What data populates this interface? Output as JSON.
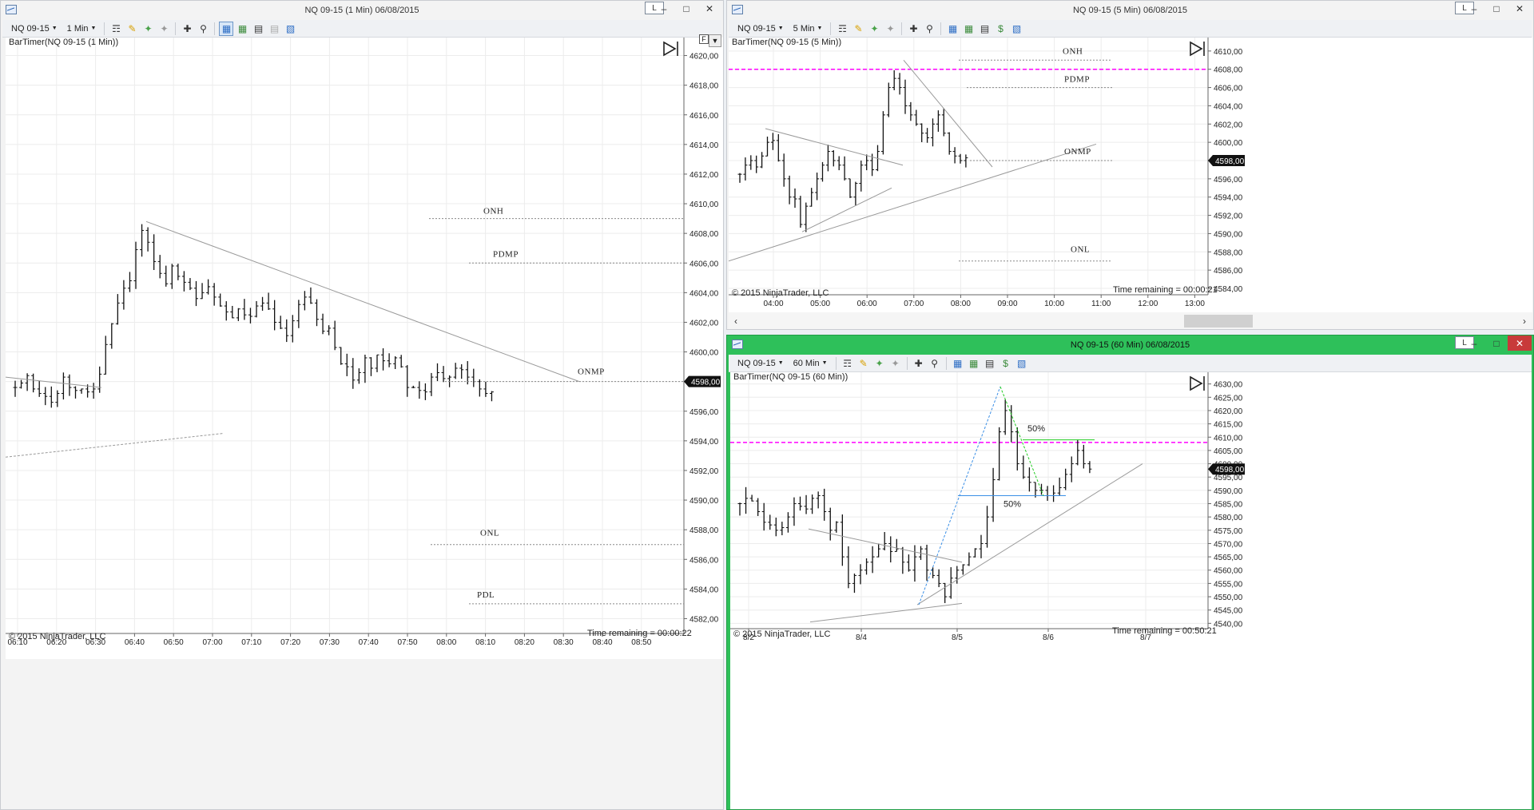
{
  "windows": {
    "left": {
      "title": "NQ 09-15 (1 Min)  06/08/2015",
      "instrument": "NQ 09-15",
      "interval": "1 Min",
      "indicator_label": "BarTimer(NQ 09-15 (1 Min))",
      "copyright": "© 2015 NinjaTrader, LLC",
      "timer": "Time remaining = 00:00:22",
      "l_button": "L",
      "f_button": "F",
      "y_ticks": [
        "4620,00",
        "4618,00",
        "4616,00",
        "4614,00",
        "4612,00",
        "4610,00",
        "4608,00",
        "4606,00",
        "4604,00",
        "4602,00",
        "4600,00",
        "4598,00",
        "4596,00",
        "4594,00",
        "4592,00",
        "4590,00",
        "4588,00",
        "4586,00",
        "4584,00",
        "4582,00"
      ],
      "price_marker": "4598,00",
      "x_ticks": [
        "06:10",
        "06:20",
        "06:30",
        "06:40",
        "06:50",
        "07:00",
        "07:10",
        "07:20",
        "07:30",
        "07:40",
        "07:50",
        "08:00",
        "08:10",
        "08:20",
        "08:30",
        "08:40",
        "08:50"
      ],
      "levels": [
        {
          "name": "ONH",
          "price": 4609.0
        },
        {
          "name": "PDMP",
          "price": 4606.0
        },
        {
          "name": "ONMP",
          "price": 4598.0
        },
        {
          "name": "ONL",
          "price": 4587.0
        },
        {
          "name": "PDL",
          "price": 4583.0
        }
      ]
    },
    "topright": {
      "title": "NQ 09-15 (5 Min)  06/08/2015",
      "instrument": "NQ 09-15",
      "interval": "5 Min",
      "indicator_label": "BarTimer(NQ 09-15 (5 Min))",
      "copyright": "© 2015 NinjaTrader, LLC",
      "timer": "Time remaining = 00:00:21",
      "l_button": "L",
      "y_ticks": [
        "4610,00",
        "4608,00",
        "4606,00",
        "4604,00",
        "4602,00",
        "4600,00",
        "4598,00",
        "4596,00",
        "4594,00",
        "4592,00",
        "4590,00",
        "4588,00",
        "4586,00",
        "4584,00"
      ],
      "price_marker": "4598,00",
      "x_ticks": [
        "04:00",
        "05:00",
        "06:00",
        "07:00",
        "08:00",
        "09:00",
        "10:00",
        "11:00",
        "12:00",
        "13:00"
      ],
      "levels": [
        {
          "name": "ONH",
          "price": 4609.0
        },
        {
          "name": "PDMP",
          "price": 4606.0
        },
        {
          "name": "ONMP",
          "price": 4598.0
        },
        {
          "name": "ONL",
          "price": 4587.0
        }
      ],
      "magenta_line": 4608.0
    },
    "bottomright": {
      "title": "NQ 09-15 (60 Min)  06/08/2015",
      "instrument": "NQ 09-15",
      "interval": "60 Min",
      "indicator_label": "BarTimer(NQ 09-15 (60 Min))",
      "copyright": "© 2015 NinjaTrader, LLC",
      "timer": "Time remaining = 00:50:21",
      "l_button": "L",
      "y_ticks": [
        "4630,00",
        "4625,00",
        "4620,00",
        "4615,00",
        "4610,00",
        "4605,00",
        "4600,00",
        "4595,00",
        "4590,00",
        "4585,00",
        "4580,00",
        "4575,00",
        "4570,00",
        "4565,00",
        "4560,00",
        "4555,00",
        "4550,00",
        "4545,00",
        "4540,00"
      ],
      "price_marker": "4598,00",
      "x_ticks": [
        "8/2",
        "8/4",
        "8/5",
        "8/6",
        "8/7"
      ],
      "fib_labels": [
        "50%",
        "50%"
      ],
      "magenta_line": 4608.0
    }
  },
  "colors": {
    "active_window": "#2ec05a",
    "magenta": "#ff00ff",
    "bars": "#111111",
    "trendline": "#999999",
    "fib_blue": "#3b8fe6",
    "fib_green": "#22cc22"
  },
  "chart_data": [
    {
      "type": "ohlc",
      "title": "NQ 09-15 (1 Min)",
      "ylim": [
        4581,
        4621
      ],
      "series": [
        {
          "name": "NQ 09-15",
          "values": [
            4597.6,
            4597.9,
            4598.4,
            4597.5,
            4597.2,
            4597.0,
            4596.6,
            4597.2,
            4598.3,
            4597.6,
            4597.4,
            4597.5,
            4597.3,
            4597.5,
            4598.5,
            4600.5,
            4601.9,
            4603.3,
            4604.3,
            4604.8,
            4606.9,
            4608.2,
            4607.4,
            4606.1,
            4605.3,
            4604.6,
            4605.8,
            4605.1,
            4604.7,
            4604.3,
            4603.6,
            4604.0,
            4604.4,
            4603.7,
            4603.1,
            4602.7,
            4602.3,
            4602.9,
            4602.5,
            4602.4,
            4603.1,
            4603.3,
            4602.9,
            4602.0,
            4601.6,
            4601.1,
            4602.1,
            4603.2,
            4603.7,
            4603.3,
            4602.2,
            4601.4,
            4601.6,
            4600.3,
            4599.2,
            4599.0,
            4598.1,
            4598.6,
            4599.6,
            4598.9,
            4599.8,
            4599.4,
            4599.2,
            4599.6,
            4599.0,
            4597.6,
            4597.6,
            4597.4,
            4597.3,
            4598.3,
            4598.6,
            4598.2,
            4598.3,
            4598.9,
            4598.8,
            4598.3,
            4598.0,
            4597.5,
            4597.2,
            4597.3
          ]
        }
      ]
    },
    {
      "type": "ohlc",
      "title": "NQ 09-15 (5 Min)",
      "ylim": [
        4583.3,
        4611.3
      ],
      "series": [
        {
          "name": "NQ 09-15",
          "values": [
            4596.5,
            4597.5,
            4598.0,
            4597.3,
            4598.5,
            4600.0,
            4600.2,
            4598.0,
            4596.0,
            4594.0,
            4593.8,
            4591.0,
            4593.0,
            4594.5,
            4596.0,
            4597.5,
            4599.0,
            4598.0,
            4597.5,
            4596.0,
            4594.0,
            4595.5,
            4597.5,
            4598.0,
            4597.0,
            4599.0,
            4603.0,
            4606.0,
            4607.0,
            4606.0,
            4604.0,
            4603.0,
            4602.0,
            4601.0,
            4600.5,
            4602.0,
            4603.0,
            4601.0,
            4599.0,
            4598.5,
            4598.0,
            4598.3
          ]
        }
      ]
    },
    {
      "type": "ohlc",
      "title": "NQ 09-15 (60 Min)",
      "ylim": [
        4538,
        4632
      ],
      "series": [
        {
          "name": "NQ 09-15",
          "values": [
            4585,
            4587,
            4586,
            4582,
            4578,
            4577,
            4575,
            4576,
            4580,
            4585,
            4584,
            4583,
            4587,
            4588,
            4582,
            4575,
            4578,
            4565,
            4555,
            4558,
            4560,
            4563,
            4565,
            4568,
            4570,
            4567,
            4568,
            4563,
            4560,
            4565,
            4568,
            4560,
            4558,
            4555,
            4550,
            4557,
            4560,
            4562,
            4565,
            4568,
            4570,
            4580,
            4594,
            4612,
            4620,
            4612,
            4600,
            4595,
            4593,
            4590,
            4590,
            4588,
            4589,
            4591,
            4596,
            4600,
            4605,
            4600,
            4598
          ]
        }
      ]
    }
  ]
}
